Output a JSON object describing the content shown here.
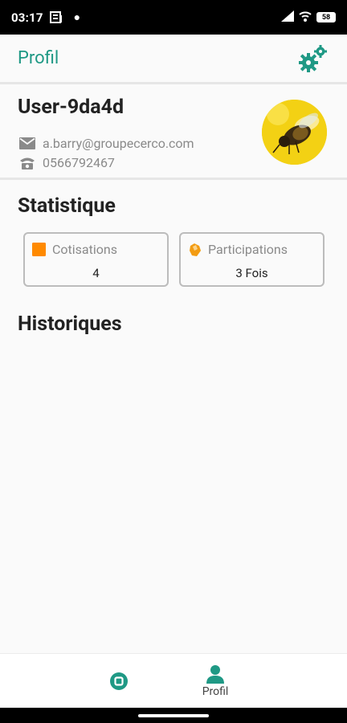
{
  "status_bar": {
    "time": "03:17",
    "battery": "58"
  },
  "app_bar": {
    "title": "Profil",
    "settings_icon": "gears-icon"
  },
  "profile": {
    "username": "User-9da4d",
    "email": "a.barry@groupecerco.com",
    "phone": "0566792467",
    "avatar": "bee-photo"
  },
  "statistics": {
    "title": "Statistique",
    "cards": [
      {
        "label": "Cotisations",
        "value": "4",
        "icon": "square-icon",
        "icon_color": "#ff8a00"
      },
      {
        "label": "Participations",
        "value": "3 Fois",
        "icon": "hand-icon",
        "icon_color": "#f39c12"
      }
    ]
  },
  "history": {
    "title": "Historiques"
  },
  "bottom_nav": {
    "items": [
      {
        "label": "",
        "icon": "home-circle-icon"
      },
      {
        "label": "Profil",
        "icon": "person-icon"
      }
    ]
  },
  "colors": {
    "accent": "#1f9985",
    "background": "#fafafa",
    "divider": "#e6e6e6"
  }
}
